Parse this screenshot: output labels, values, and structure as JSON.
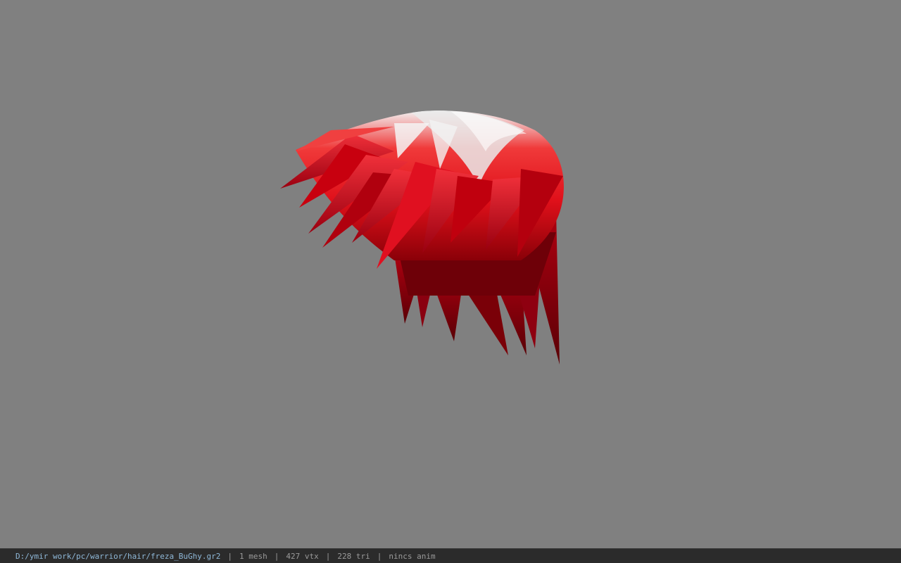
{
  "viewport": {
    "background_color": "#808080",
    "model": {
      "description_name": "red-spiky-hair-mesh",
      "primary_color": "#e0101a",
      "dark_color": "#7a0008",
      "highlight_color": "#e8e8e8"
    }
  },
  "status_bar": {
    "path": "D:/ymir work/pc/warrior/hair/freza_BuGhy.gr2",
    "separator": "|",
    "mesh_count": "1 mesh",
    "vertex_count": "427 vtx",
    "triangle_count": "228 tri",
    "anim_status": "nincs anim"
  }
}
